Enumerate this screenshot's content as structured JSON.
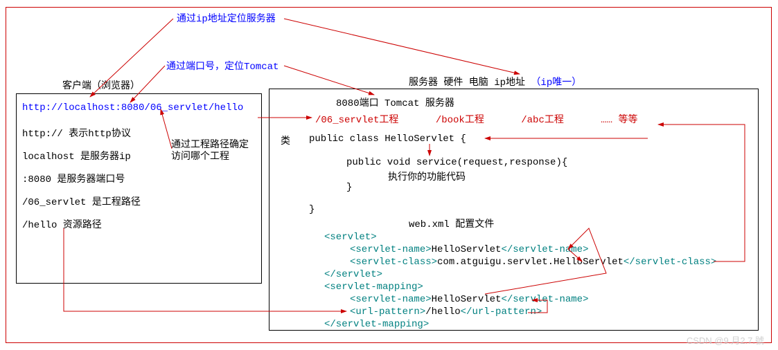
{
  "annotations": {
    "ip_locate": "通过ip地址定位服务器",
    "port_locate": "通过端口号，定位Tomcat",
    "project_path_note1": "通过工程路径确定",
    "project_path_note2": "访问哪个工程"
  },
  "client": {
    "title": "客户端（浏览器）",
    "url": "http://localhost:8080/06_servlet/hello",
    "line_protocol": "http:// 表示http协议",
    "line_host": "localhost 是服务器ip",
    "line_port": ":8080 是服务器端口号",
    "line_project": "/06_servlet 是工程路径",
    "line_resource": "/hello  资源路径"
  },
  "server": {
    "title_main": "服务器 硬件 电脑   ip地址",
    "title_ip_unique": "（ip唯一）",
    "port_line": "8080端口 Tomcat 服务器",
    "proj1": "/06_servlet工程",
    "proj2": "/book工程",
    "proj3": "/abc工程",
    "proj_etc": "…… 等等",
    "class_label": "类",
    "class_decl": "public class HelloServlet {",
    "method_decl": "public void service(request,response){",
    "method_body": "执行你的功能代码",
    "brace_close1": "}",
    "brace_close2": "}",
    "webxml_title": "web.xml 配置文件",
    "xml_servlet_open": "<servlet>",
    "xml_servlet_name1_open": "<servlet-name>",
    "xml_servlet_name1_val": "HelloServlet",
    "xml_servlet_name1_close": "</servlet-name>",
    "xml_servlet_class_open": "<servlet-class>",
    "xml_servlet_class_val": "com.atguigu.servlet.HelloServlet",
    "xml_servlet_class_close": "</servlet-class>",
    "xml_servlet_close": "</servlet>",
    "xml_mapping_open": "<servlet-mapping>",
    "xml_servlet_name2_open": "<servlet-name>",
    "xml_servlet_name2_val": "HelloServlet",
    "xml_servlet_name2_close": "</servlet-name>",
    "xml_url_open": "<url-pattern>",
    "xml_url_val": "/hello",
    "xml_url_close": "</url-pattern>",
    "xml_mapping_close": "</servlet-mapping>"
  },
  "watermark": "CSDN @9.月2.7.號"
}
